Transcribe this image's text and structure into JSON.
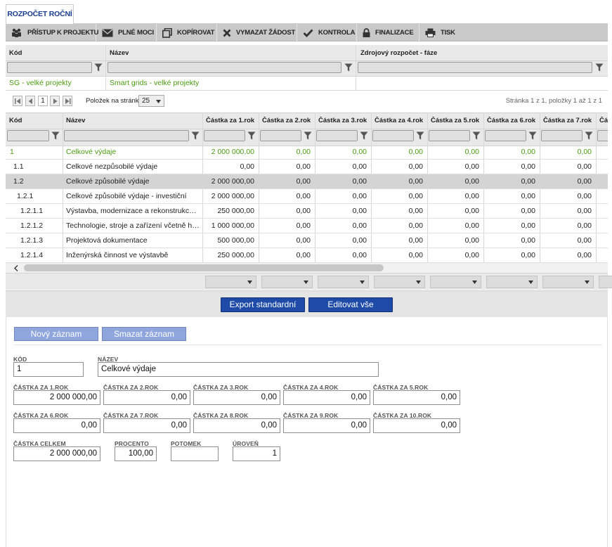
{
  "tab": {
    "label": "ROZPOČET ROČNÍ"
  },
  "toolbar": [
    {
      "icon": "people-icon",
      "label": "PŘÍSTUP K PROJEKTU"
    },
    {
      "icon": "envelope-icon",
      "label": "PLNÉ MOCI"
    },
    {
      "icon": "copy-icon",
      "label": "KOPÍROVAT"
    },
    {
      "icon": "x-icon",
      "label": "VYMAZAT ŽÁDOST"
    },
    {
      "icon": "check-icon",
      "label": "KONTROLA"
    },
    {
      "icon": "lock-icon",
      "label": "FINALIZACE"
    },
    {
      "icon": "printer-icon",
      "label": "TISK"
    }
  ],
  "grid1": {
    "columns": [
      "Kód",
      "Název",
      "Zdrojový rozpočet - fáze"
    ],
    "row": [
      "SG - velké projekty",
      "Smart grids - velké projekty",
      ""
    ]
  },
  "pager": {
    "page": "1",
    "per_page_label": "Položek na stránku",
    "per_page_value": "25",
    "summary": "Stránka 1 z 1, položky 1 až 1 z 1"
  },
  "grid2": {
    "columns": [
      "Kód",
      "Název",
      "Částka za 1.rok",
      "Částka za 2.rok",
      "Částka za 3.rok",
      "Částka za 4.rok",
      "Částka za 5.rok",
      "Částka za 6.rok",
      "Částka za 7.rok",
      "Čá"
    ],
    "rows": [
      {
        "code": "1",
        "name": "Celkové výdaje",
        "v": [
          "2 000 000,00",
          "0,00",
          "0,00",
          "0,00",
          "0,00",
          "0,00",
          "0,00"
        ],
        "style": "green"
      },
      {
        "code": "1.1",
        "name": "Celkové nezpůsobilé výdaje",
        "v": [
          "0,00",
          "0,00",
          "0,00",
          "0,00",
          "0,00",
          "0,00",
          "0,00"
        ],
        "style": ""
      },
      {
        "code": "1.2",
        "name": "Celkové způsobilé výdaje",
        "v": [
          "2 000 000,00",
          "0,00",
          "0,00",
          "0,00",
          "0,00",
          "0,00",
          "0,00"
        ],
        "style": "sel"
      },
      {
        "code": "1.2.1",
        "name": "Celkové způsobilé výdaje - investiční",
        "v": [
          "2 000 000,00",
          "0,00",
          "0,00",
          "0,00",
          "0,00",
          "0,00",
          "0,00"
        ],
        "style": ""
      },
      {
        "code": "1.2.1.1",
        "name": "Výstavba, modernizace a rekonstrukce př...",
        "v": [
          "250 000,00",
          "0,00",
          "0,00",
          "0,00",
          "0,00",
          "0,00",
          "0,00"
        ],
        "style": ""
      },
      {
        "code": "1.2.1.2",
        "name": "Technologie, stroje a zařízení včetně hard...",
        "v": [
          "1 000 000,00",
          "0,00",
          "0,00",
          "0,00",
          "0,00",
          "0,00",
          "0,00"
        ],
        "style": ""
      },
      {
        "code": "1.2.1.3",
        "name": "Projektová dokumentace",
        "v": [
          "500 000,00",
          "0,00",
          "0,00",
          "0,00",
          "0,00",
          "0,00",
          "0,00"
        ],
        "style": ""
      },
      {
        "code": "1.2.1.4",
        "name": "Inženýrská činnost ve výstavbě",
        "v": [
          "250 000,00",
          "0,00",
          "0,00",
          "0,00",
          "0,00",
          "0,00",
          "0,00"
        ],
        "style": ""
      }
    ]
  },
  "actions": {
    "export": "Export standardní",
    "edit_all": "Editovat vše"
  },
  "form": {
    "new": "Nový záznam",
    "delete": "Smazat záznam",
    "fields": [
      {
        "label": "KÓD",
        "value": "1"
      },
      {
        "label": "NÁZEV",
        "value": "Celkové výdaje"
      },
      {
        "label": "ČÁSTKA ZA 1.ROK",
        "value": "2 000 000,00"
      },
      {
        "label": "ČÁSTKA ZA 2.ROK",
        "value": "0,00"
      },
      {
        "label": "ČÁSTKA ZA 3.ROK",
        "value": "0,00"
      },
      {
        "label": "ČÁSTKA ZA 4.ROK",
        "value": "0,00"
      },
      {
        "label": "ČÁSTKA ZA 5.ROK",
        "value": "0,00"
      },
      {
        "label": "ČÁSTKA ZA 6.ROK",
        "value": "0,00"
      },
      {
        "label": "ČÁSTKA ZA 7.ROK",
        "value": "0,00"
      },
      {
        "label": "ČÁSTKA ZA 8.ROK",
        "value": "0,00"
      },
      {
        "label": "ČÁSTKA ZA 9.ROK",
        "value": "0,00"
      },
      {
        "label": "ČÁSTKA ZA 10.ROK",
        "value": "0,00"
      },
      {
        "label": "ČÁSTKA CELKEM",
        "value": "2 000 000,00"
      },
      {
        "label": "PROCENTO",
        "value": "100,00"
      },
      {
        "label": "POTOMEK",
        "value": ""
      },
      {
        "label": "ÚROVEŇ",
        "value": "1"
      }
    ]
  },
  "colors": {
    "accent": "#1e4aa8",
    "green": "#4a9a10",
    "toolbar": "#c9c9c9"
  }
}
